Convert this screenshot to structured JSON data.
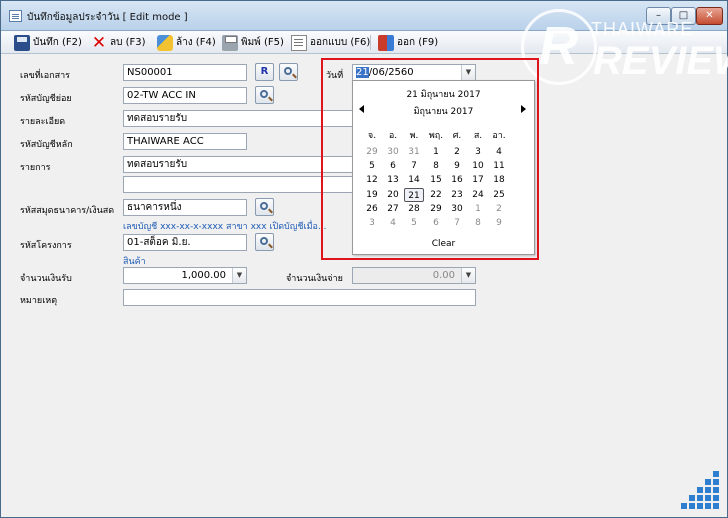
{
  "window": {
    "title": "บันทึกข้อมูลประจำวัน [ Edit mode ]",
    "min": "–",
    "max": "□",
    "close": "✕"
  },
  "toolbar": {
    "save": "บันทึก (F2)",
    "delete": "ลบ (F3)",
    "clear": "ล้าง (F4)",
    "print": "พิมพ์ (F5)",
    "design": "ออกแบบ (F6)",
    "exit": "ออก (F9)"
  },
  "form": {
    "doc_no_label": "เลขที่เอกสาร",
    "doc_no": "NS00001",
    "r_button": "R",
    "sub_account_label": "รหัสบัญชีย่อย",
    "sub_account": "02-TW ACC IN",
    "detail_label": "รายละเอียด",
    "detail": "ทดสอบรายรับ",
    "main_account_label": "รหัสบัญชีหลัก",
    "main_account": "THAIWARE ACC",
    "item_label": "รายการ",
    "item": "ทดสอบรายรับ",
    "item2": "",
    "bank_label": "รหัสสมุดธนาคาร/เงินสด",
    "bank": "ธนาคารหนึ่ง",
    "bank_info": "เลขบัญชี xxx-xx-x-xxxx สาขา xxx เปิดบัญชีเมื่อ...",
    "project_label": "รหัสโครงการ",
    "project": "01-สต็อค มิ.ย.",
    "project_info": "สินค้า",
    "income_label": "จำนวนเงินรับ",
    "income": "1,000.00",
    "expense_label": "จำนวนเงินจ่าย",
    "expense": "0.00",
    "note_label": "หมายเหตุ",
    "note": "",
    "date_label": "วันที่",
    "date_day": "21",
    "date_rest": "/06/2560"
  },
  "calendar": {
    "header": "21 มิถุนายน 2017",
    "month": "มิถุนายน 2017",
    "dow": [
      "จ.",
      "อ.",
      "พ.",
      "พฤ.",
      "ศ.",
      "ส.",
      "อา."
    ],
    "weeks": [
      [
        "29",
        "30",
        "31",
        "1",
        "2",
        "3",
        "4"
      ],
      [
        "5",
        "6",
        "7",
        "8",
        "9",
        "10",
        "11"
      ],
      [
        "12",
        "13",
        "14",
        "15",
        "16",
        "17",
        "18"
      ],
      [
        "19",
        "20",
        "21",
        "22",
        "23",
        "24",
        "25"
      ],
      [
        "26",
        "27",
        "28",
        "29",
        "30",
        "1",
        "2"
      ],
      [
        "3",
        "4",
        "5",
        "6",
        "7",
        "8",
        "9"
      ]
    ],
    "other_month": [
      [
        0,
        0
      ],
      [
        0,
        1
      ],
      [
        0,
        2
      ],
      [
        4,
        5
      ],
      [
        4,
        6
      ],
      [
        5,
        0
      ],
      [
        5,
        1
      ],
      [
        5,
        2
      ],
      [
        5,
        3
      ],
      [
        5,
        4
      ],
      [
        5,
        5
      ],
      [
        5,
        6
      ]
    ],
    "selected": [
      3,
      2
    ],
    "clear": "Clear"
  },
  "watermark": {
    "r": "R",
    "line1": "THAIWARE",
    "line2": "REVIEW"
  },
  "colors": {
    "highlight": "#e0141e",
    "link": "#1e5bb5",
    "grip": "#2e7fd0"
  }
}
